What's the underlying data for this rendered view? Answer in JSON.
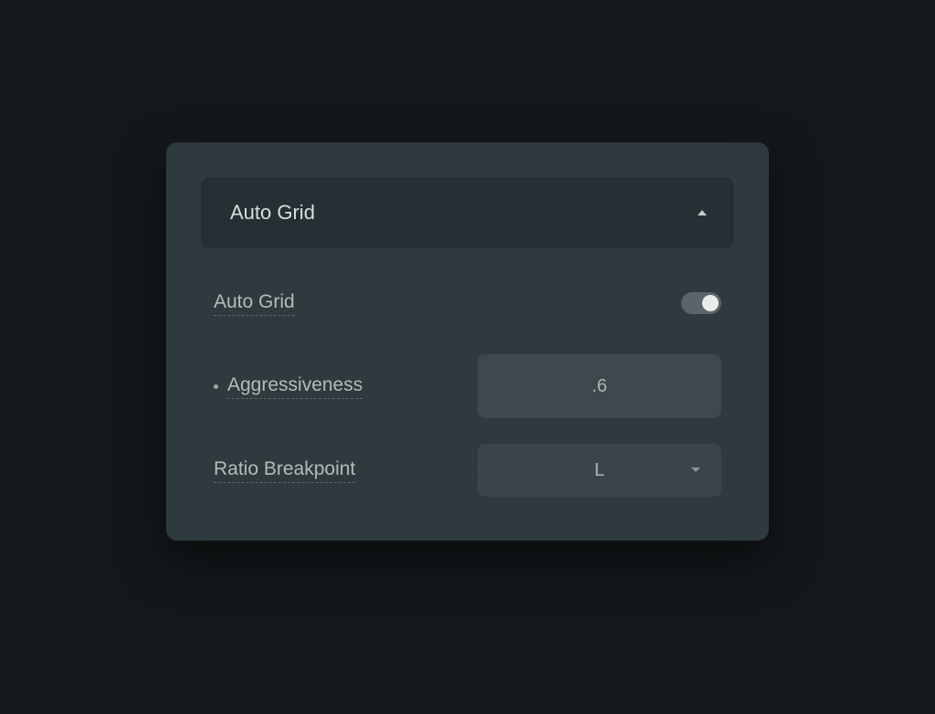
{
  "section": {
    "title": "Auto Grid"
  },
  "settings": {
    "autoGrid": {
      "label": "Auto Grid",
      "enabled": true
    },
    "aggressiveness": {
      "label": "Aggressiveness",
      "value": ".6"
    },
    "ratioBreakpoint": {
      "label": "Ratio Breakpoint",
      "value": "L"
    }
  }
}
